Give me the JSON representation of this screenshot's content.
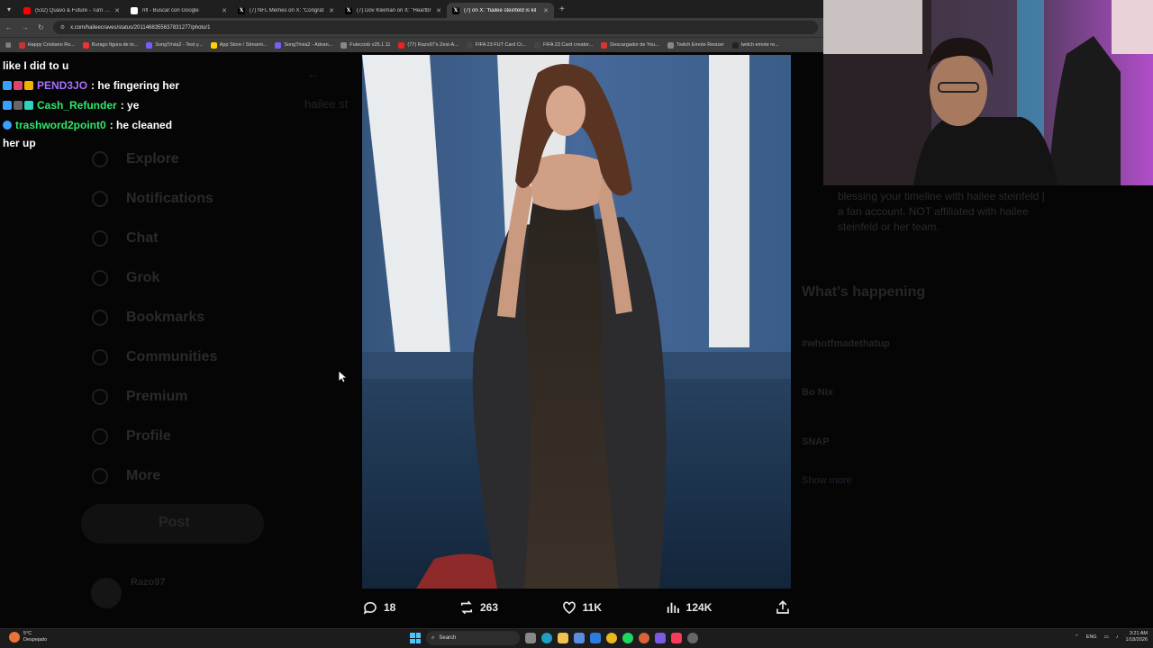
{
  "browser": {
    "tabs": [
      {
        "title": "(532) Quavo & Future - Turn Yo",
        "icon": "youtube-icon",
        "color": "#ff0000",
        "active": false
      },
      {
        "title": "nfl - Buscar con Google",
        "icon": "google-icon",
        "color": "#ffffff",
        "active": false
      },
      {
        "title": "(7) NFL Memes on X: \"Congrat",
        "icon": "x-icon",
        "color": "#000000",
        "active": false
      },
      {
        "title": "(7) Dov Kleiman on X: \"Heartbr",
        "icon": "x-icon",
        "color": "#000000",
        "active": false
      },
      {
        "title": "(7) on X: \"hailee steinfeld is kil",
        "icon": "x-icon",
        "color": "#000000",
        "active": true
      }
    ],
    "url": "x.com/haileecraves/status/2011468355637831277/photo/1",
    "bookmarks": [
      {
        "label": "Happy Cristiano Ro...",
        "color": "#c33"
      },
      {
        "label": "Burago figura de to...",
        "color": "#e33"
      },
      {
        "label": "SongTrivia2 - Test y...",
        "color": "#7a5cff"
      },
      {
        "label": "App Store / Streami...",
        "color": "#ffd400"
      },
      {
        "label": "SongTrivia2 - Advan...",
        "color": "#7a5cff"
      },
      {
        "label": "Futecoob v25.1.11",
        "color": "#888"
      },
      {
        "label": "(77) Razo97's Zest-A...",
        "color": "#e22"
      },
      {
        "label": "FIFA 23 FUT Card Cr...",
        "color": "#444"
      },
      {
        "label": "FIFA 23 Card creator...",
        "color": "#444"
      },
      {
        "label": "Descargador de You...",
        "color": "#d33"
      },
      {
        "label": "Twitch Emote Resizer",
        "color": "#888"
      },
      {
        "label": "twitch emote re...",
        "color": "#222"
      }
    ]
  },
  "chat": {
    "first_line": "like I did to u",
    "messages": [
      {
        "user": "PEND3JO",
        "user_color": "#a970ff",
        "text": ": he fingering her"
      },
      {
        "user": "Cash_Refunder",
        "user_color": "#2ee86e",
        "text": ": ye"
      },
      {
        "user": "trashword2point0",
        "user_color": "#2ee86e",
        "text": ": he cleaned",
        "continuation": "her up"
      }
    ]
  },
  "background": {
    "search_text": "hailee st",
    "nav": [
      "Explore",
      "Notifications",
      "Chat",
      "Grok",
      "Bookmarks",
      "Communities",
      "Premium",
      "Profile",
      "More"
    ],
    "post_button": "Post",
    "profile_name": "Razo97",
    "bio": "blessing your timeline with hailee steinfeld | a fan account. NOT affiliated with hailee steinfeld or her team.",
    "happening_title": "What's happening",
    "trends": [
      "#whotfmadethatup",
      "Bo Nix",
      "SNAP"
    ],
    "show_more": "Show more"
  },
  "photo_actions": {
    "replies": "18",
    "reposts": "263",
    "likes": "11K",
    "views": "124K"
  },
  "taskbar": {
    "weather_temp": "5°C",
    "weather_desc": "Despejado",
    "search_label": "Search",
    "lang": "ENG",
    "time": "3:21 AM",
    "date": "1/18/2026"
  }
}
